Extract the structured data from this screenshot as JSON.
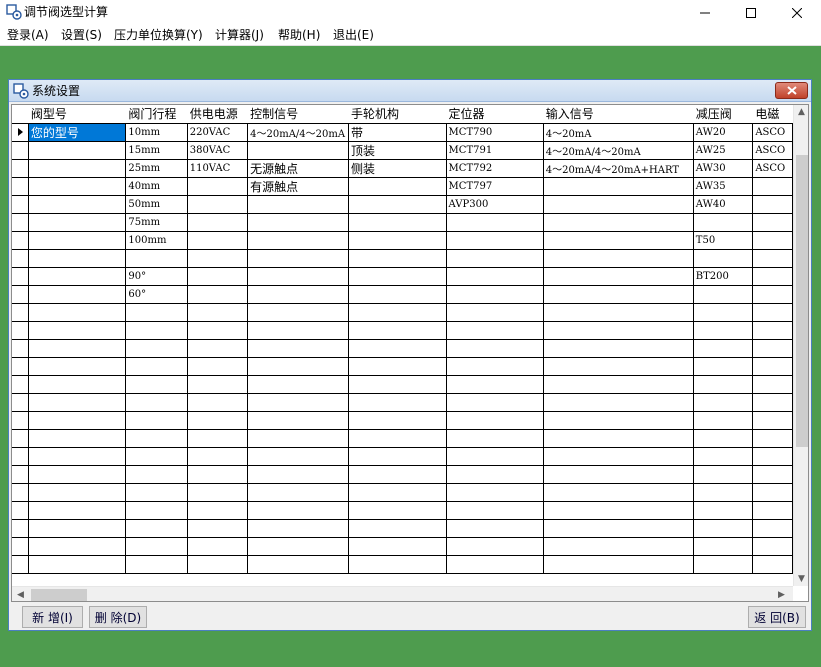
{
  "window": {
    "title": "调节阀选型计算"
  },
  "menu": [
    "登录(A)",
    "设置(S)",
    "压力单位换算(Y)",
    "计算器(J)",
    "帮助(H)",
    "退出(E)"
  ],
  "dialog": {
    "title": "系统设置"
  },
  "grid": {
    "columns": [
      "阀型号",
      "阀门行程",
      "供电电源",
      "控制信号",
      "手轮机构",
      "定位器",
      "输入信号",
      "减压阀",
      "电磁"
    ],
    "rows": [
      [
        "您的型号",
        "10mm",
        "220VAC",
        "4～20mA/4～20mA",
        "带",
        "MCT790",
        "4～20mA",
        "AW20",
        "ASCO"
      ],
      [
        "",
        "15mm",
        "380VAC",
        "",
        "顶装",
        "MCT791",
        "4～20mA/4～20mA",
        "AW25",
        "ASCO"
      ],
      [
        "",
        "25mm",
        "110VAC",
        "无源触点",
        "侧装",
        "MCT792",
        "4～20mA/4～20mA+HART",
        "AW30",
        "ASCO"
      ],
      [
        "",
        "40mm",
        "",
        "有源触点",
        "",
        "MCT797",
        "",
        "AW35",
        ""
      ],
      [
        "",
        "50mm",
        "",
        "",
        "",
        "AVP300",
        "",
        "AW40",
        ""
      ],
      [
        "",
        "75mm",
        "",
        "",
        "",
        "",
        "",
        "",
        ""
      ],
      [
        "",
        "100mm",
        "",
        "",
        "",
        "",
        "",
        "T50",
        ""
      ],
      [
        "",
        "",
        "",
        "",
        "",
        "",
        "",
        "",
        ""
      ],
      [
        "",
        "90°",
        "",
        "",
        "",
        "",
        "",
        "BT200",
        ""
      ],
      [
        "",
        "60°",
        "",
        "",
        "",
        "",
        "",
        "",
        ""
      ]
    ],
    "empty_rows": 15
  },
  "buttons": {
    "add": "新 增(I)",
    "delete": "删 除(D)",
    "return": "返 回(B)"
  },
  "colors": {
    "selection": "#0078d7",
    "background": "#4e9c4e",
    "close": "#c0422a"
  }
}
